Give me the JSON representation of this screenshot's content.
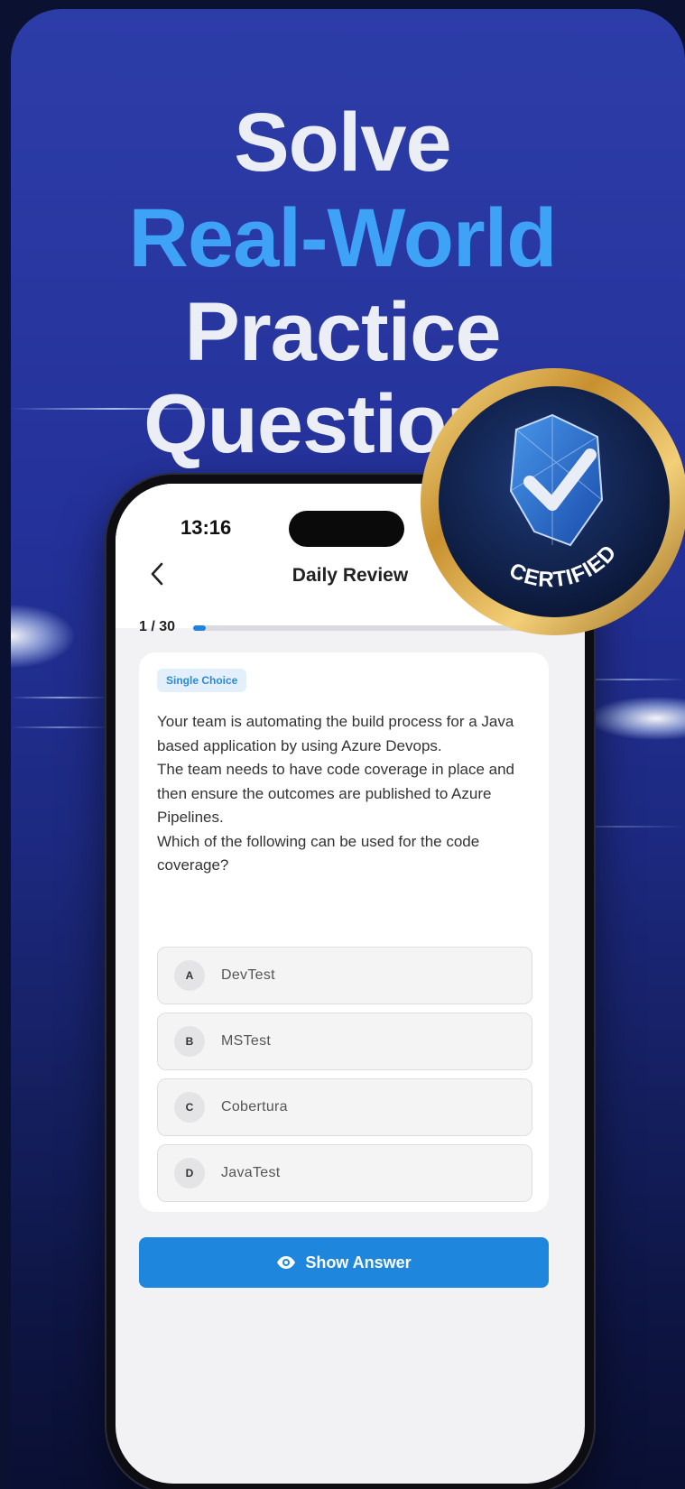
{
  "headline": {
    "line1": "Solve",
    "line2": "Real-World",
    "line3": "Practice",
    "line4": "Questions"
  },
  "colors": {
    "accent_blue": "#3ea2f6",
    "button_blue": "#1e86dc",
    "background_top": "#2d3da8",
    "background_bottom": "#0a1033"
  },
  "status_bar": {
    "time": "13:16"
  },
  "nav": {
    "title": "Daily Review",
    "back_icon": "chevron-left-icon"
  },
  "progress": {
    "label": "1 / 30",
    "fraction": 0.0333
  },
  "question": {
    "type_badge": "Single Choice",
    "text": "Your team is automating the build process for a Java based application by using Azure Devops.\nThe team needs to have code coverage in place and then ensure the outcomes are published to Azure Pipelines.\nWhich of the following can be used for the code coverage?",
    "options": [
      {
        "letter": "A",
        "text": "DevTest"
      },
      {
        "letter": "B",
        "text": "MSTest"
      },
      {
        "letter": "C",
        "text": "Cobertura"
      },
      {
        "letter": "D",
        "text": "JavaTest"
      }
    ]
  },
  "actions": {
    "show_answer_label": "Show Answer",
    "show_answer_icon": "eye-icon"
  },
  "seal": {
    "label": "CERTIFIED",
    "icon": "shield-check-icon"
  }
}
